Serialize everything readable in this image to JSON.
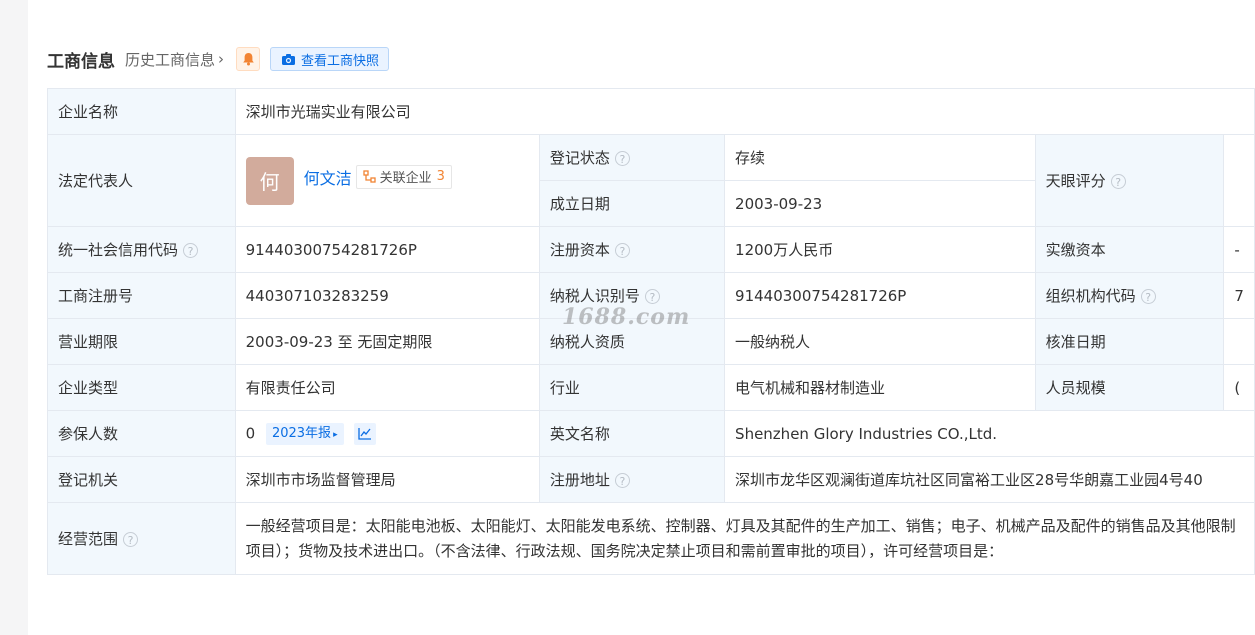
{
  "header": {
    "title": "工商信息",
    "history_link": "历史工商信息",
    "snapshot_button": "查看工商快照"
  },
  "rows": {
    "company_name": {
      "label": "企业名称",
      "value": "深圳市光瑞实业有限公司"
    },
    "legal_rep": {
      "label": "法定代表人",
      "avatar_char": "何",
      "name": "何文洁",
      "related_label": "关联企业",
      "related_count": "3"
    },
    "reg_status": {
      "label": "登记状态",
      "value": "存续"
    },
    "found_date": {
      "label": "成立日期",
      "value": "2003-09-23"
    },
    "tianyan_score": {
      "label": "天眼评分"
    },
    "credit_code": {
      "label": "统一社会信用代码",
      "value": "91440300754281726P"
    },
    "reg_capital": {
      "label": "注册资本",
      "value": "1200万人民币"
    },
    "paid_capital": {
      "label": "实缴资本",
      "value": "-"
    },
    "reg_number": {
      "label": "工商注册号",
      "value": "440307103283259"
    },
    "taxpayer_id": {
      "label": "纳税人识别号",
      "value": "91440300754281726P"
    },
    "org_code": {
      "label": "组织机构代码",
      "value": "7"
    },
    "term": {
      "label": "营业期限",
      "value": "2003-09-23 至 无固定期限"
    },
    "taxpayer_quality": {
      "label": "纳税人资质",
      "value": "一般纳税人"
    },
    "approval_date": {
      "label": "核准日期",
      "value": ""
    },
    "company_type": {
      "label": "企业类型",
      "value": "有限责任公司"
    },
    "industry": {
      "label": "行业",
      "value": "电气机械和器材制造业"
    },
    "staff_size": {
      "label": "人员规模",
      "value": "("
    },
    "insured": {
      "label": "参保人数",
      "value": "0",
      "year_tag": "2023年报"
    },
    "english_name": {
      "label": "英文名称",
      "value": "Shenzhen Glory Industries CO.,Ltd."
    },
    "reg_authority": {
      "label": "登记机关",
      "value": "深圳市市场监督管理局"
    },
    "reg_address": {
      "label": "注册地址",
      "value": "深圳市龙华区观澜街道库坑社区同富裕工业区28号华朗嘉工业园4号40"
    },
    "business_scope": {
      "label": "经营范围",
      "value": "一般经营项目是：太阳能电池板、太阳能灯、太阳能发电系统、控制器、灯具及其配件的生产加工、销售；电子、机械产品及配件的销售品及其他限制项目）；货物及技术进出口。（不含法律、行政法规、国务院决定禁止项目和需前置审批的项目），许可经营项目是："
    }
  },
  "watermark": "1688.com",
  "colors": {
    "accent": "#0b6ee3",
    "status_green": "#2aa15a",
    "label_bg": "#f2f8fd",
    "avatar_bg": "#d2ab9c",
    "count_orange": "#f28433"
  }
}
